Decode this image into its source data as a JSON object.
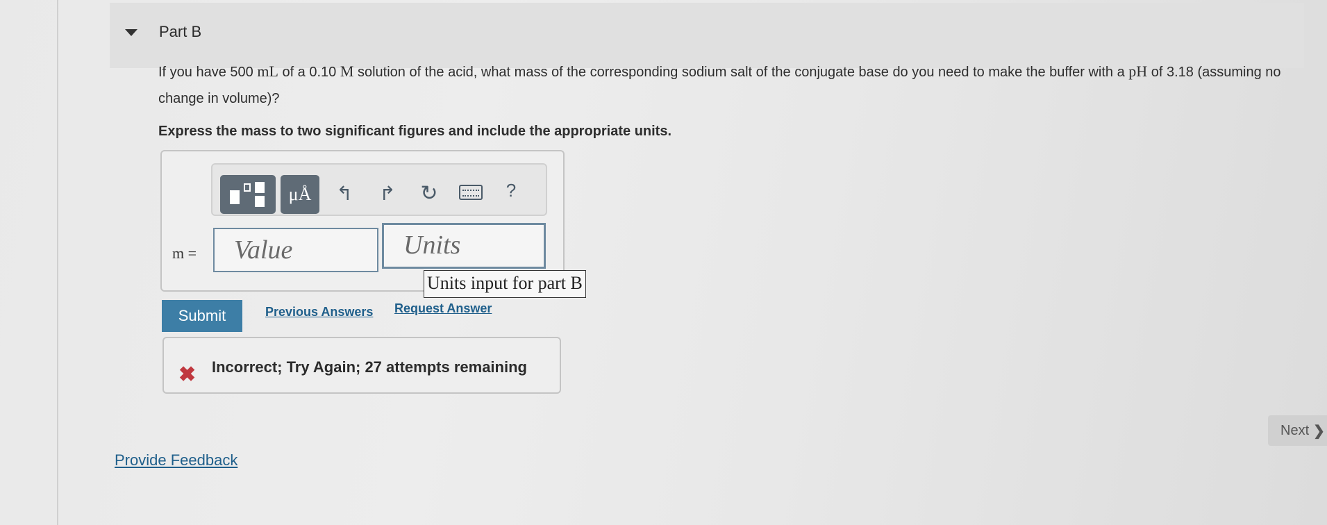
{
  "part": {
    "title": "Part B"
  },
  "question": {
    "t1": "If you have 500 ",
    "m1": "mL",
    "t2": " of a 0.10 ",
    "m2": "M",
    "t3": " solution of the acid, what mass of the corresponding sodium salt of the conjugate base do you need to make the buffer with a ",
    "m3": "pH",
    "t4": " of 3.18 (assuming no change in volume)?",
    "instruction": "Express the mass to two significant figures and include the appropriate units."
  },
  "toolbar": {
    "units_label": "μÅ",
    "undo_symbol": "↰",
    "redo_symbol": "↱",
    "reset_symbol": "↻",
    "help_label": "?",
    "icons": [
      "templates-icon",
      "units-icon",
      "undo-icon",
      "redo-icon",
      "reset-icon",
      "keyboard-icon",
      "help-icon"
    ]
  },
  "answer": {
    "variable_label": "m =",
    "value_placeholder": "Value",
    "units_placeholder": "Units",
    "units_tooltip": "Units input for part B"
  },
  "actions": {
    "submit_label": "Submit",
    "previous_answers_label": "Previous Answers",
    "request_answer_label": "Request Answer"
  },
  "feedback": {
    "icon": "x-icon",
    "message": "Incorrect; Try Again; 27 attempts remaining",
    "color": "#c0383f"
  },
  "navigation": {
    "next_label": "Next",
    "next_chevron": "❯"
  },
  "footer": {
    "provide_feedback_label": "Provide Feedback"
  },
  "colors": {
    "accent": "#3d7ea6",
    "link": "#1f5f8b",
    "toolbar_dark": "#5f6b76"
  }
}
